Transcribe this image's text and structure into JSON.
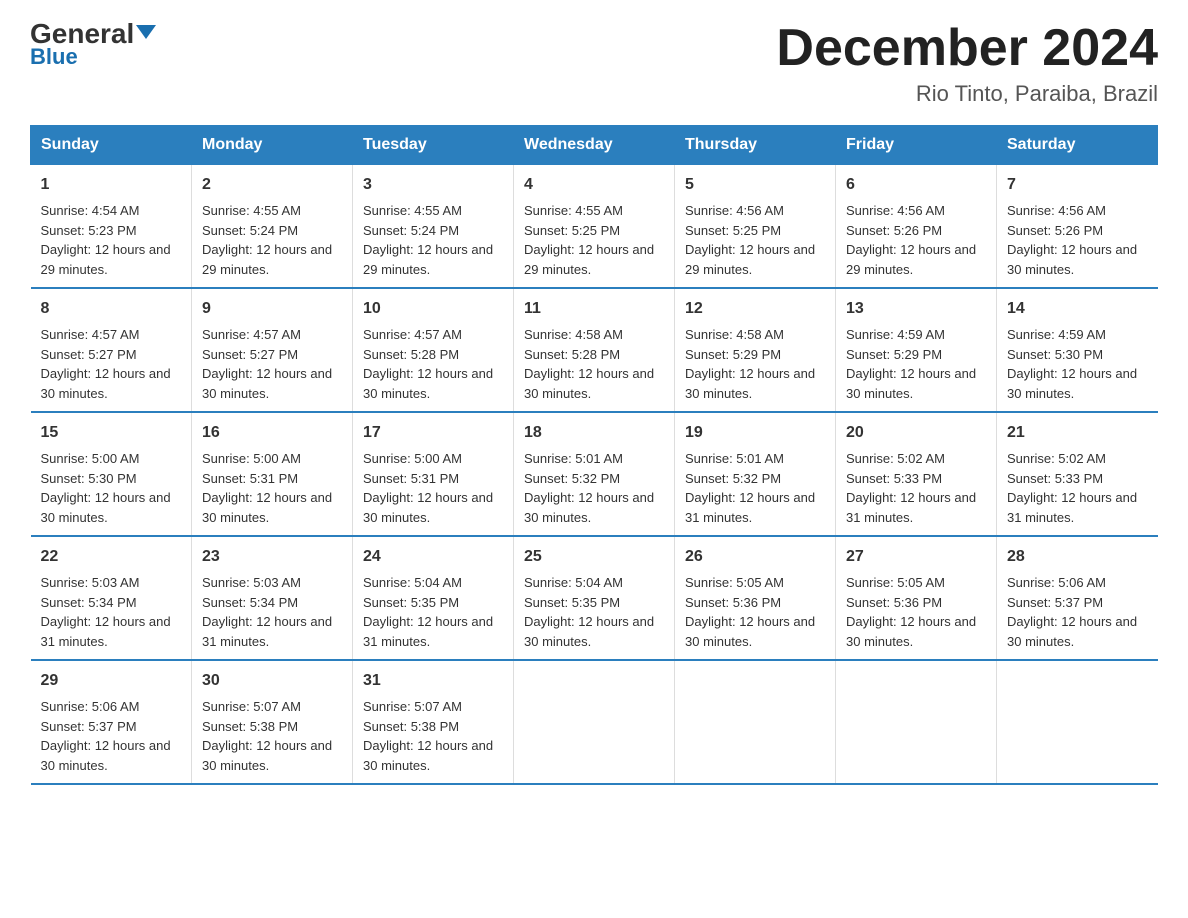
{
  "header": {
    "logo_main": "General",
    "logo_blue": "Blue",
    "month_title": "December 2024",
    "location": "Rio Tinto, Paraiba, Brazil"
  },
  "days_of_week": [
    "Sunday",
    "Monday",
    "Tuesday",
    "Wednesday",
    "Thursday",
    "Friday",
    "Saturday"
  ],
  "weeks": [
    [
      {
        "num": "1",
        "sunrise": "4:54 AM",
        "sunset": "5:23 PM",
        "daylight": "12 hours and 29 minutes."
      },
      {
        "num": "2",
        "sunrise": "4:55 AM",
        "sunset": "5:24 PM",
        "daylight": "12 hours and 29 minutes."
      },
      {
        "num": "3",
        "sunrise": "4:55 AM",
        "sunset": "5:24 PM",
        "daylight": "12 hours and 29 minutes."
      },
      {
        "num": "4",
        "sunrise": "4:55 AM",
        "sunset": "5:25 PM",
        "daylight": "12 hours and 29 minutes."
      },
      {
        "num": "5",
        "sunrise": "4:56 AM",
        "sunset": "5:25 PM",
        "daylight": "12 hours and 29 minutes."
      },
      {
        "num": "6",
        "sunrise": "4:56 AM",
        "sunset": "5:26 PM",
        "daylight": "12 hours and 29 minutes."
      },
      {
        "num": "7",
        "sunrise": "4:56 AM",
        "sunset": "5:26 PM",
        "daylight": "12 hours and 30 minutes."
      }
    ],
    [
      {
        "num": "8",
        "sunrise": "4:57 AM",
        "sunset": "5:27 PM",
        "daylight": "12 hours and 30 minutes."
      },
      {
        "num": "9",
        "sunrise": "4:57 AM",
        "sunset": "5:27 PM",
        "daylight": "12 hours and 30 minutes."
      },
      {
        "num": "10",
        "sunrise": "4:57 AM",
        "sunset": "5:28 PM",
        "daylight": "12 hours and 30 minutes."
      },
      {
        "num": "11",
        "sunrise": "4:58 AM",
        "sunset": "5:28 PM",
        "daylight": "12 hours and 30 minutes."
      },
      {
        "num": "12",
        "sunrise": "4:58 AM",
        "sunset": "5:29 PM",
        "daylight": "12 hours and 30 minutes."
      },
      {
        "num": "13",
        "sunrise": "4:59 AM",
        "sunset": "5:29 PM",
        "daylight": "12 hours and 30 minutes."
      },
      {
        "num": "14",
        "sunrise": "4:59 AM",
        "sunset": "5:30 PM",
        "daylight": "12 hours and 30 minutes."
      }
    ],
    [
      {
        "num": "15",
        "sunrise": "5:00 AM",
        "sunset": "5:30 PM",
        "daylight": "12 hours and 30 minutes."
      },
      {
        "num": "16",
        "sunrise": "5:00 AM",
        "sunset": "5:31 PM",
        "daylight": "12 hours and 30 minutes."
      },
      {
        "num": "17",
        "sunrise": "5:00 AM",
        "sunset": "5:31 PM",
        "daylight": "12 hours and 30 minutes."
      },
      {
        "num": "18",
        "sunrise": "5:01 AM",
        "sunset": "5:32 PM",
        "daylight": "12 hours and 30 minutes."
      },
      {
        "num": "19",
        "sunrise": "5:01 AM",
        "sunset": "5:32 PM",
        "daylight": "12 hours and 31 minutes."
      },
      {
        "num": "20",
        "sunrise": "5:02 AM",
        "sunset": "5:33 PM",
        "daylight": "12 hours and 31 minutes."
      },
      {
        "num": "21",
        "sunrise": "5:02 AM",
        "sunset": "5:33 PM",
        "daylight": "12 hours and 31 minutes."
      }
    ],
    [
      {
        "num": "22",
        "sunrise": "5:03 AM",
        "sunset": "5:34 PM",
        "daylight": "12 hours and 31 minutes."
      },
      {
        "num": "23",
        "sunrise": "5:03 AM",
        "sunset": "5:34 PM",
        "daylight": "12 hours and 31 minutes."
      },
      {
        "num": "24",
        "sunrise": "5:04 AM",
        "sunset": "5:35 PM",
        "daylight": "12 hours and 31 minutes."
      },
      {
        "num": "25",
        "sunrise": "5:04 AM",
        "sunset": "5:35 PM",
        "daylight": "12 hours and 30 minutes."
      },
      {
        "num": "26",
        "sunrise": "5:05 AM",
        "sunset": "5:36 PM",
        "daylight": "12 hours and 30 minutes."
      },
      {
        "num": "27",
        "sunrise": "5:05 AM",
        "sunset": "5:36 PM",
        "daylight": "12 hours and 30 minutes."
      },
      {
        "num": "28",
        "sunrise": "5:06 AM",
        "sunset": "5:37 PM",
        "daylight": "12 hours and 30 minutes."
      }
    ],
    [
      {
        "num": "29",
        "sunrise": "5:06 AM",
        "sunset": "5:37 PM",
        "daylight": "12 hours and 30 minutes."
      },
      {
        "num": "30",
        "sunrise": "5:07 AM",
        "sunset": "5:38 PM",
        "daylight": "12 hours and 30 minutes."
      },
      {
        "num": "31",
        "sunrise": "5:07 AM",
        "sunset": "5:38 PM",
        "daylight": "12 hours and 30 minutes."
      },
      null,
      null,
      null,
      null
    ]
  ]
}
